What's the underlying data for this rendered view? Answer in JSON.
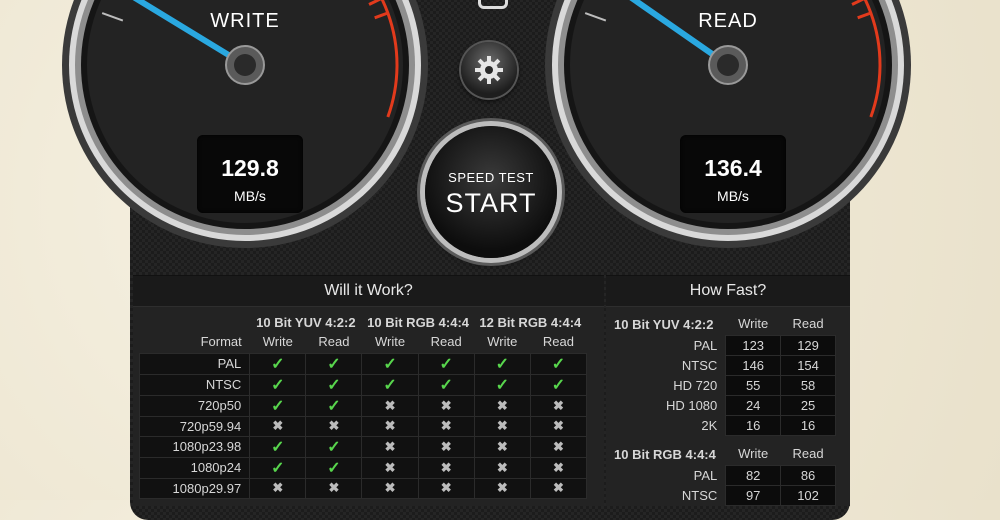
{
  "write": {
    "label": "WRITE",
    "value": "129.8",
    "unit": "MB/s"
  },
  "read": {
    "label": "READ",
    "value": "136.4",
    "unit": "MB/s"
  },
  "start_button": {
    "small": "SPEED TEST",
    "big": "START"
  },
  "will_it_work": {
    "title": "Will it Work?",
    "format_label": "Format",
    "groups": [
      "10 Bit YUV 4:2:2",
      "10 Bit RGB 4:4:4",
      "12 Bit RGB 4:4:4"
    ],
    "sub_headers": [
      "Write",
      "Read"
    ],
    "rows": [
      {
        "format": "PAL",
        "marks": [
          "check",
          "check",
          "check",
          "check",
          "check",
          "check"
        ]
      },
      {
        "format": "NTSC",
        "marks": [
          "check",
          "check",
          "check",
          "check",
          "check",
          "check"
        ]
      },
      {
        "format": "720p50",
        "marks": [
          "check",
          "check",
          "cross",
          "cross",
          "cross",
          "cross"
        ]
      },
      {
        "format": "720p59.94",
        "marks": [
          "cross",
          "cross",
          "cross",
          "cross",
          "cross",
          "cross"
        ]
      },
      {
        "format": "1080p23.98",
        "marks": [
          "check",
          "check",
          "cross",
          "cross",
          "cross",
          "cross"
        ]
      },
      {
        "format": "1080p24",
        "marks": [
          "check",
          "check",
          "cross",
          "cross",
          "cross",
          "cross"
        ]
      },
      {
        "format": "1080p29.97",
        "marks": [
          "cross",
          "cross",
          "cross",
          "cross",
          "cross",
          "cross"
        ]
      }
    ]
  },
  "how_fast": {
    "title": "How Fast?",
    "sections": [
      {
        "name": "10 Bit YUV 4:2:2",
        "write_label": "Write",
        "read_label": "Read",
        "rows": [
          {
            "format": "PAL",
            "write": "123",
            "read": "129"
          },
          {
            "format": "NTSC",
            "write": "146",
            "read": "154"
          },
          {
            "format": "HD 720",
            "write": "55",
            "read": "58"
          },
          {
            "format": "HD 1080",
            "write": "24",
            "read": "25"
          },
          {
            "format": "2K",
            "write": "16",
            "read": "16"
          }
        ]
      },
      {
        "name": "10 Bit RGB 4:4:4",
        "write_label": "Write",
        "read_label": "Read",
        "rows": [
          {
            "format": "PAL",
            "write": "82",
            "read": "86"
          },
          {
            "format": "NTSC",
            "write": "97",
            "read": "102"
          }
        ]
      }
    ]
  },
  "colors": {
    "check": "#58d64d",
    "number": "#43e63f",
    "needle": "#2aa8e0",
    "redzone": "#e23a1c"
  },
  "icons": {
    "settings": "gear-icon",
    "check": "check-icon",
    "cross": "cross-icon"
  }
}
